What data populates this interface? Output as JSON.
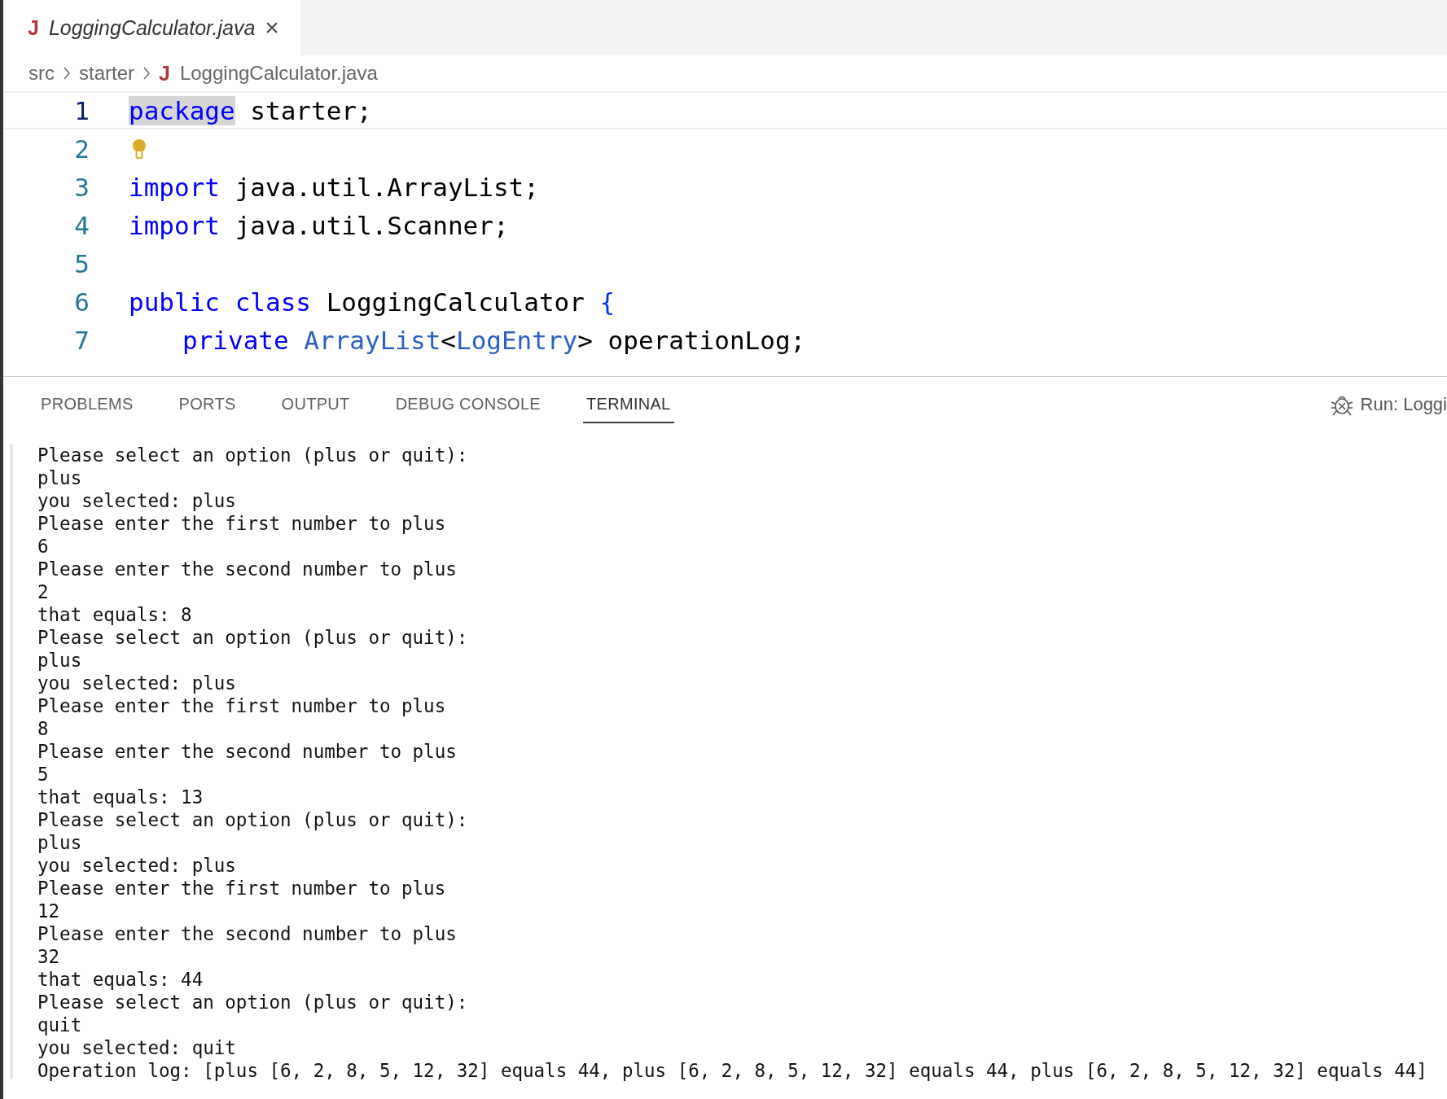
{
  "editor_tab": {
    "icon": "J",
    "title": "LoggingCalculator.java",
    "close": "×",
    "selected": true
  },
  "breadcrumbs": [
    {
      "label": "src"
    },
    {
      "label": "starter"
    },
    {
      "label": "LoggingCalculator.java",
      "icon": "J"
    }
  ],
  "code_lines": [
    {
      "number": "1",
      "active": true,
      "tokens": [
        {
          "kind": "keyword",
          "text": "package",
          "highlighted": true
        },
        {
          "kind": "plain",
          "text": " starter;"
        }
      ]
    },
    {
      "number": "2",
      "active": false,
      "lightbulb": true
    },
    {
      "number": "3",
      "active": false,
      "tokens": [
        {
          "kind": "keyword",
          "text": "import"
        },
        {
          "kind": "plain",
          "text": " java.util.ArrayList;"
        }
      ]
    },
    {
      "number": "4",
      "active": false,
      "tokens": [
        {
          "kind": "keyword",
          "text": "import"
        },
        {
          "kind": "plain",
          "text": " java.util.Scanner;"
        }
      ]
    },
    {
      "number": "5",
      "active": false
    },
    {
      "number": "6",
      "active": false,
      "tokens": [
        {
          "kind": "keyword",
          "text": "public"
        },
        {
          "kind": "keyword",
          "text": " class"
        },
        {
          "kind": "plain",
          "text": " LoggingCalculator "
        },
        {
          "kind": "bracket",
          "text": "{"
        }
      ]
    },
    {
      "number": "7",
      "active": false,
      "indented": true,
      "tokens": [
        {
          "kind": "keyword",
          "text": "private"
        },
        {
          "kind": "type",
          "text": " ArrayList"
        },
        {
          "kind": "plain",
          "text": "<"
        },
        {
          "kind": "type",
          "text": "LogEntry"
        },
        {
          "kind": "plain",
          "text": "> operationLog;"
        }
      ]
    }
  ],
  "panel_tabs": [
    {
      "label": "PROBLEMS",
      "selected": false
    },
    {
      "label": "PORTS",
      "selected": false
    },
    {
      "label": "OUTPUT",
      "selected": false
    },
    {
      "label": "DEBUG CONSOLE",
      "selected": false
    },
    {
      "label": "TERMINAL",
      "selected": true
    }
  ],
  "run_session": {
    "label": "Run: Loggi"
  },
  "terminal_lines": [
    "Please select an option (plus or quit):",
    "plus",
    "you selected: plus",
    "Please enter the first number to plus",
    "6",
    "Please enter the second number to plus",
    "2",
    "that equals: 8",
    "Please select an option (plus or quit):",
    "plus",
    "you selected: plus",
    "Please enter the first number to plus",
    "8",
    "Please enter the second number to plus",
    "5",
    "that equals: 13",
    "Please select an option (plus or quit):",
    "plus",
    "you selected: plus",
    "Please enter the first number to plus",
    "12",
    "Please enter the second number to plus",
    "32",
    "that equals: 44",
    "Please select an option (plus or quit):",
    "quit",
    "you selected: quit",
    "Operation log: [plus [6, 2, 8, 5, 12, 32] equals 44, plus [6, 2, 8, 5, 12, 32] equals 44, plus [6, 2, 8, 5, 12, 32] equals 44]"
  ]
}
